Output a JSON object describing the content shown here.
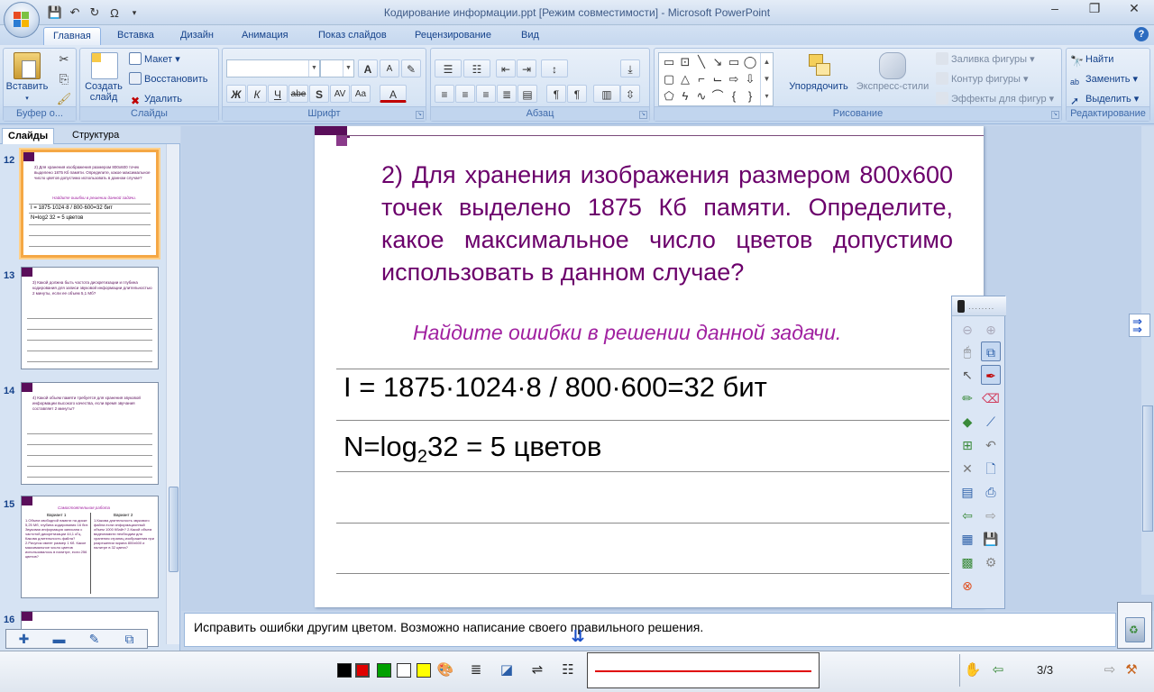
{
  "window": {
    "title": "Кодирование информации.ppt [Режим совместимости] - Microsoft PowerPoint",
    "controls": [
      "–",
      "❐",
      "✕"
    ]
  },
  "ribbon": {
    "tabs": [
      "Главная",
      "Вставка",
      "Дизайн",
      "Анимация",
      "Показ слайдов",
      "Рецензирование",
      "Вид"
    ],
    "active_tab": "Главная",
    "clipboard": {
      "paste_label": "Вставить",
      "group_label": "Буфер о..."
    },
    "slides": {
      "new_slide_label": "Создать слайд",
      "layout_label": "Макет",
      "reset_label": "Восстановить",
      "delete_label": "Удалить",
      "group_label": "Слайды"
    },
    "font": {
      "group_label": "Шрифт",
      "bold": "Ж",
      "italic": "К",
      "underline": "Ч",
      "strike": "abe",
      "shadow": "S",
      "spacing": "AV",
      "case": "Aa",
      "color": "A",
      "grow": "A",
      "shrink": "A"
    },
    "paragraph": {
      "group_label": "Абзац"
    },
    "drawing": {
      "arrange_label": "Упорядочить",
      "quick_styles_label": "Экспресс-стили",
      "fill_label": "Заливка фигуры",
      "outline_label": "Контур фигуры",
      "effects_label": "Эффекты для фигур",
      "group_label": "Рисование"
    },
    "editing": {
      "find_label": "Найти",
      "replace_label": "Заменить",
      "select_label": "Выделить",
      "group_label": "Редактирование"
    }
  },
  "left_pane": {
    "tabs": [
      "Слайды",
      "Структура"
    ],
    "close": "x",
    "slides": [
      {
        "number": "12",
        "text": "2) Для хранения изображения размером 800x600 точек выделено 1875 Кб памяти. Определите, какое максимальное число цветов допустимо использовать в данном случае?",
        "hint": "Найдите ошибки в решении данной задачи.",
        "line1": "I = 1875·1024·8 / 800·600=32 бит",
        "line2": "N=log2 32 = 5 цветов"
      },
      {
        "number": "13",
        "text": "3) Какой должна быть частота дискретизации и глубина кодирования для записи звуковой информации длительностью 2 минуты, если ее объем 5,1 Мб?"
      },
      {
        "number": "14",
        "text": "4) Какой объем памяти требуется для хранения звуковой информации высокого качества, если время звучания составляет 2 минуты?"
      },
      {
        "number": "15",
        "title": "Самостоятельная работа",
        "col1_head": "Вариант 1",
        "col2_head": "Вариант 2",
        "col1": "1.Объем свободной памяти на диске 5,25 Мб, глубина кодирования 16 бит. Звуковая информация записана с частотой дискретизации 44,1 кГц. Какова длительность файла? 2.Рисунок имеет размер 1 Кб. Какое максимальное число цветов использовалось в палитре, если 256 цветов?",
        "col2": "1.Какова длительность звукового файла если информационный объем 1000 Кбайт? 2.Какой объем видеопамяти необходим для хранения страниц изображения при разрешении экрана 800x600 и палитре в 32 цвета?"
      },
      {
        "number": "16"
      }
    ]
  },
  "slide": {
    "question": "2) Для хранения изображения размером 800x600 точек выделено 1875 Кб памяти. Определите, какое максимальное число цветов допустимо использовать в данном случае?",
    "hint": "Найдите ошибки в решении данной задачи.",
    "formula1": "I = 1875·1024·8 / 800·600=32 бит",
    "formula2_pre": "N=log",
    "formula2_sub": "2",
    "formula2_post": "32 = 5 цветов"
  },
  "notes": {
    "text": "Исправить ошибки другим цветом. Возможно написание своего правильного решения."
  },
  "bottom_toolbar": {
    "colors": [
      "#000000",
      "#e00000",
      "#00a000",
      "#ffffff",
      "#ffff00"
    ],
    "pen_color": "#e00000",
    "page_counter": "3/3"
  }
}
